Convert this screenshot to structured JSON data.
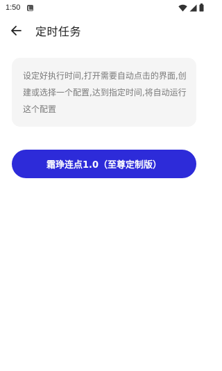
{
  "status_bar": {
    "time": "1:50",
    "icons": [
      "notification-icon",
      "wifi-icon",
      "cell-signal-icon",
      "battery-icon"
    ]
  },
  "app_bar": {
    "back_icon": "arrow-back-icon",
    "title": "定时任务"
  },
  "info_card": {
    "text": "设定好执行时间,打开需要自动点击的界面,创建或选择一个配置,达到指定时间,将自动运行这个配置"
  },
  "action_button": {
    "label": "霜琤连点1.0（至尊定制版）"
  },
  "colors": {
    "accent": "#2d2bd9",
    "card_background": "#f5f5f5",
    "secondary_text": "#7a7a7a"
  }
}
